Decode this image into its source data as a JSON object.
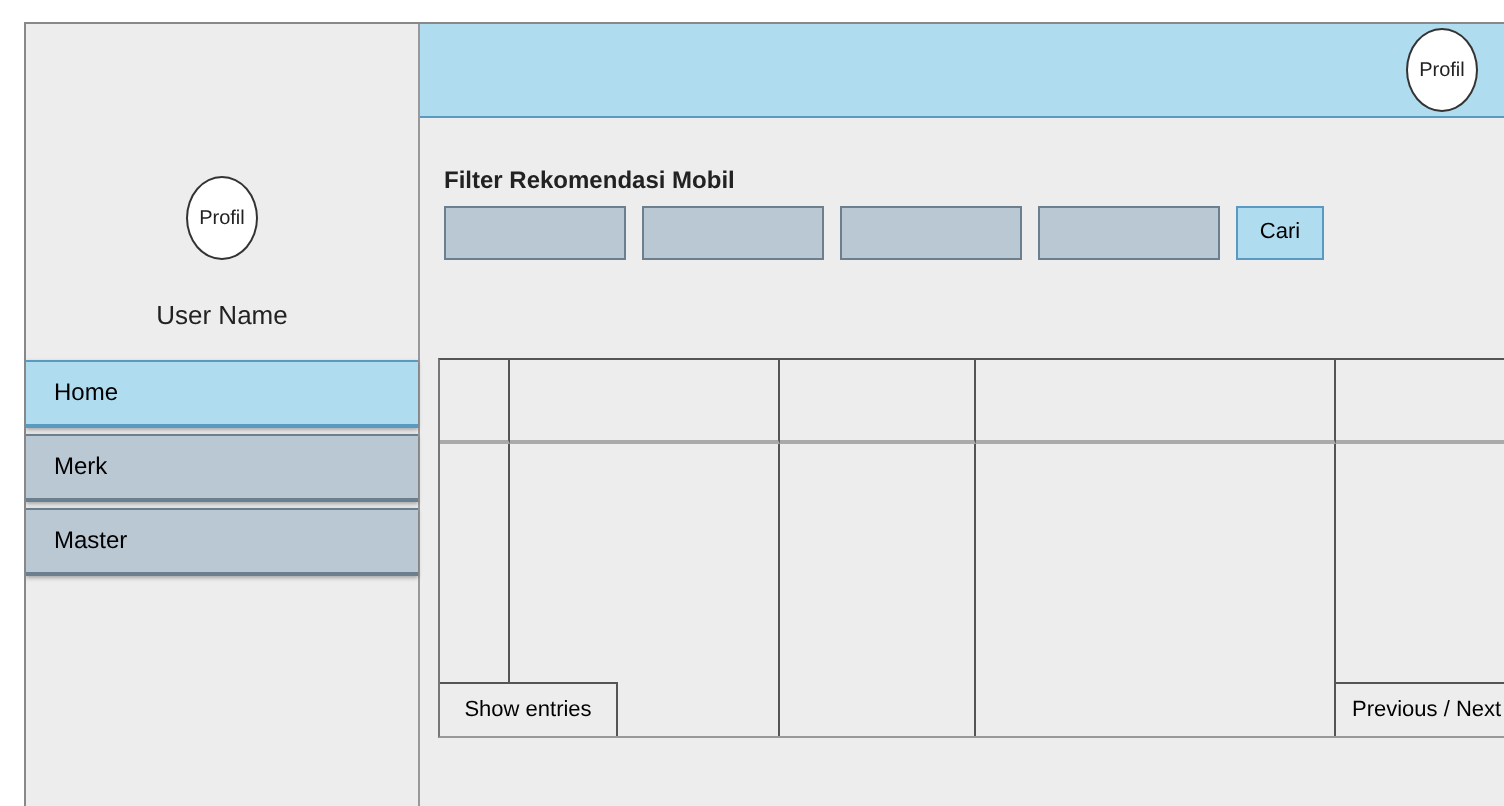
{
  "sidebar": {
    "avatar_label": "Profil",
    "user_name": "User Name",
    "items": [
      {
        "label": "Home",
        "selected": true
      },
      {
        "label": "Merk",
        "selected": false
      },
      {
        "label": "Master",
        "selected": false
      }
    ]
  },
  "header": {
    "avatar_label": "Profil"
  },
  "filter": {
    "title": "Filter Rekomendasi Mobil",
    "fields": [
      {
        "kind": "text"
      },
      {
        "kind": "text"
      },
      {
        "kind": "text"
      },
      {
        "kind": "text"
      }
    ],
    "button": "Cari"
  },
  "table": {
    "show_entries": "Show entries",
    "pagination": "Previous / Next"
  }
}
